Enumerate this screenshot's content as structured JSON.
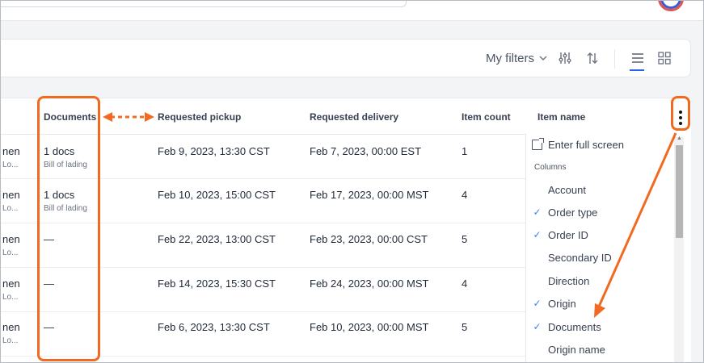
{
  "toolbar": {
    "my_filters_label": "My filters",
    "icons": [
      "chevron-down-icon",
      "sliders-icon",
      "sort-icon",
      "list-view-icon",
      "grid-view-icon"
    ]
  },
  "table": {
    "headers": {
      "documents": "Documents",
      "requested_pickup": "Requested pickup",
      "requested_delivery": "Requested delivery",
      "item_count": "Item count",
      "item_name": "Item name"
    },
    "rows": [
      {
        "cut_main": "nen",
        "cut_sub": "Lo...",
        "documents": "1 docs",
        "documents_sub": "Bill of lading",
        "pickup": "Feb 9, 2023, 13:30 CST",
        "delivery": "Feb 7, 2023, 00:00 EST",
        "count": "1"
      },
      {
        "cut_main": "nen",
        "cut_sub": "Lo...",
        "documents": "1 docs",
        "documents_sub": "Bill of lading",
        "pickup": "Feb 10, 2023, 15:00 CST",
        "delivery": "Feb 17, 2023, 00:00 MST",
        "count": "4"
      },
      {
        "cut_main": "nen",
        "cut_sub": "Lo...",
        "documents": "—",
        "documents_sub": "",
        "pickup": "Feb 22, 2023, 13:00 CST",
        "delivery": "Feb 23, 2023, 00:00 CST",
        "count": "5"
      },
      {
        "cut_main": "nen",
        "cut_sub": "Lo...",
        "documents": "—",
        "documents_sub": "",
        "pickup": "Feb 14, 2023, 15:30 CST",
        "delivery": "Feb 24, 2023, 00:00 MST",
        "count": "4"
      },
      {
        "cut_main": "nen",
        "cut_sub": "Lo...",
        "documents": "—",
        "documents_sub": "",
        "pickup": "Feb 6, 2023, 13:30 CST",
        "delivery": "Feb 10, 2023, 00:00 MST",
        "count": "5"
      }
    ]
  },
  "column_menu": {
    "fullscreen_label": "Enter full screen",
    "section_label": "Columns",
    "items": [
      {
        "label": "Account",
        "checked": false
      },
      {
        "label": "Order type",
        "checked": true
      },
      {
        "label": "Order ID",
        "checked": true
      },
      {
        "label": "Secondary ID",
        "checked": false
      },
      {
        "label": "Direction",
        "checked": false
      },
      {
        "label": "Origin",
        "checked": true
      },
      {
        "label": "Documents",
        "checked": true
      },
      {
        "label": "Origin name",
        "checked": false
      }
    ]
  },
  "colors": {
    "annotation": "#f26a21",
    "check": "#3b82f6",
    "active_view": "#2563eb"
  }
}
